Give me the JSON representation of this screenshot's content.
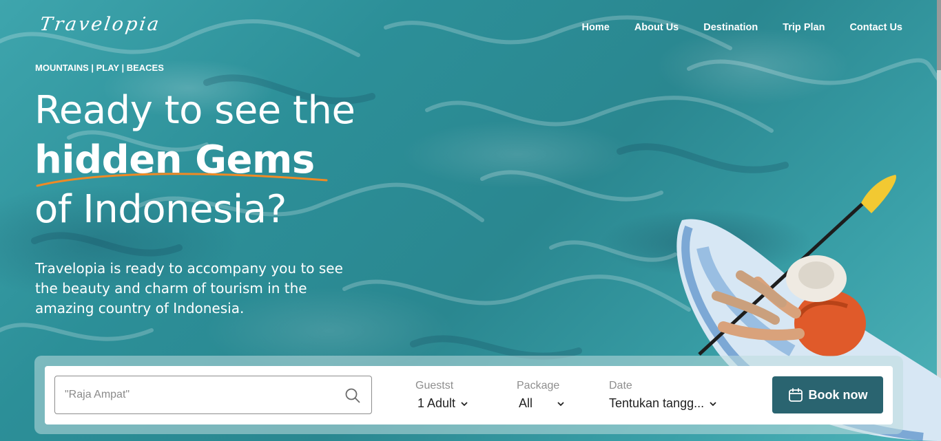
{
  "brand": {
    "logo": "Travelopia"
  },
  "nav": {
    "items": [
      "Home",
      "About Us",
      "Destination",
      "Trip Plan",
      "Contact Us"
    ]
  },
  "hero": {
    "tagline": "MOUNTAINS | PLAY | BEACES",
    "headline_line1": "Ready to see the",
    "headline_emphasis": "hidden Gems",
    "headline_line3": "of Indonesia?",
    "subtitle": "Travelopia is ready to accompany you to see the beauty and charm of tourism in the amazing country of Indonesia."
  },
  "booking": {
    "search_placeholder": "\"Raja Ampat\"",
    "guests_label": "Guestst",
    "guests_value": "1 Adult",
    "package_label": "Package",
    "package_value": "All",
    "date_label": "Date",
    "date_value": "Tentukan tangg...",
    "book_label": "Book now"
  },
  "colors": {
    "accent_underline": "#f08a24",
    "book_button": "#2a6470",
    "water": "#2c8f98"
  },
  "icons": [
    "search-icon",
    "calendar-icon",
    "chevron-down-icon"
  ]
}
